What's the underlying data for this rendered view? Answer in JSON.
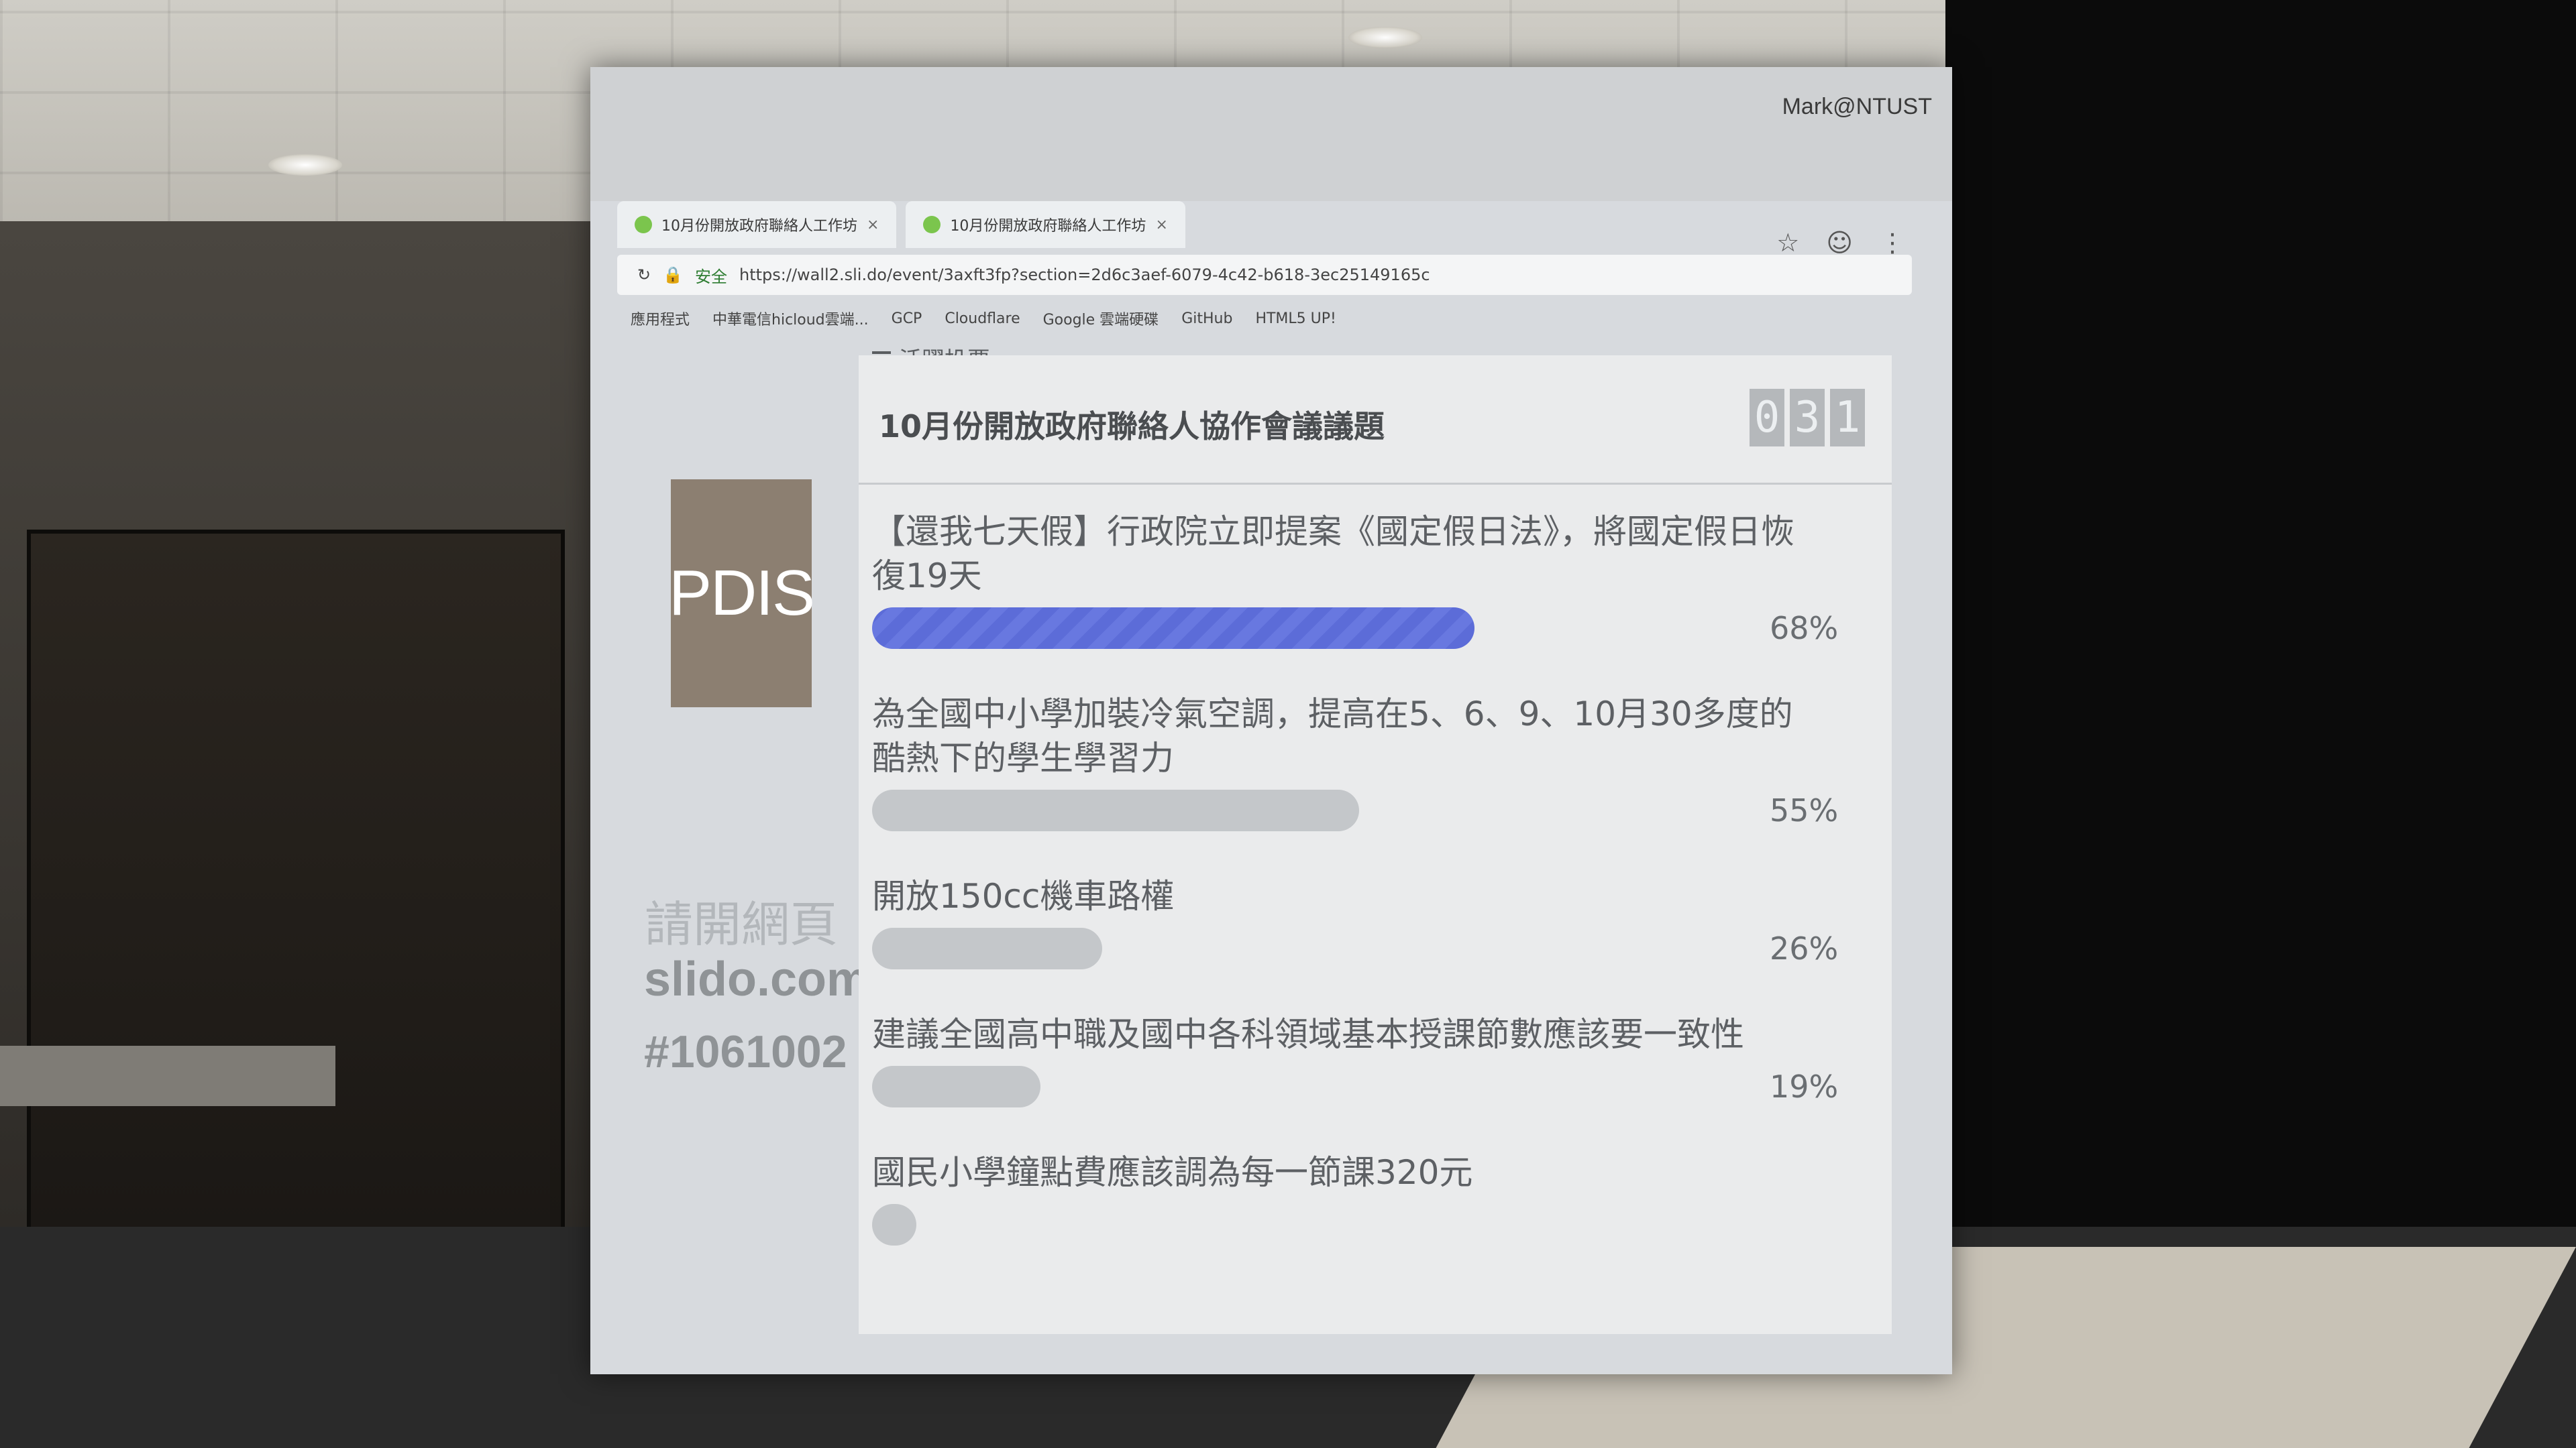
{
  "watermark": "Mark@NTUST",
  "browser": {
    "tabs": [
      {
        "label": "10月份開放政府聯絡人工作坊"
      },
      {
        "label": "10月份開放政府聯絡人工作坊"
      }
    ],
    "secure_label": "安全",
    "url": "https://wall2.sli.do/event/3axft3fp?section=2d6c3aef-6079-4c42-b618-3ec25149165c",
    "bookmarks": [
      "應用程式",
      "中華電信hicloud雲端...",
      "GCP",
      "Cloudflare",
      "Google 雲端硬碟",
      "GitHub",
      "HTML5 UP!"
    ]
  },
  "sidebar": {
    "logo_text": "PDIS",
    "join_text": "請開網頁",
    "join_site": "slido.com",
    "join_code": "#1061002"
  },
  "poll": {
    "section_label": "活躍投票",
    "title": "10月份開放政府聯絡人協作會議議題",
    "counter_digits": [
      "0",
      "3",
      "1"
    ],
    "options": [
      {
        "label": "【還我七天假】行政院立即提案《國定假日法》，將國定假日恢復19天",
        "percent": 68,
        "percent_label": "68%",
        "leader": true
      },
      {
        "label": "為全國中小學加裝冷氣空調，提高在5、6、9、10月30多度的酷熱下的學生學習力",
        "percent": 55,
        "percent_label": "55%",
        "leader": false
      },
      {
        "label": "開放150cc機車路權",
        "percent": 26,
        "percent_label": "26%",
        "leader": false
      },
      {
        "label": "建議全國高中職及國中各科領域基本授課節數應該要一致性",
        "percent": 19,
        "percent_label": "19%",
        "leader": false
      },
      {
        "label": "國民小學鐘點費應該調為每一節課320元",
        "percent": 5,
        "percent_label": "",
        "leader": false
      }
    ]
  }
}
